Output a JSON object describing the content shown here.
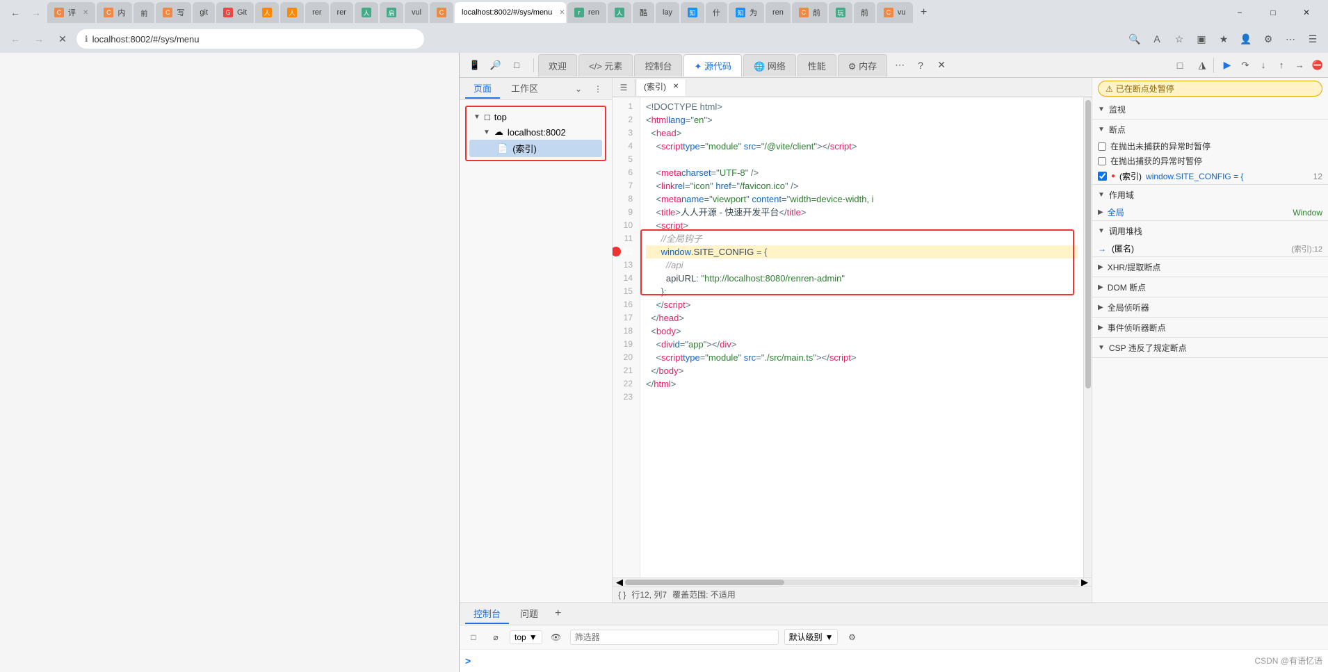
{
  "browser": {
    "url": "localhost:8002/#/sys/menu",
    "tabs": [
      {
        "id": "t1",
        "label": "C 评",
        "active": false,
        "favicon_color": "#e84"
      },
      {
        "id": "t2",
        "label": "C 内",
        "active": false,
        "favicon_color": "#e84"
      },
      {
        "id": "t3",
        "label": "前",
        "active": false,
        "favicon_color": "#e84"
      },
      {
        "id": "t4",
        "label": "C 写",
        "active": false,
        "favicon_color": "#e84"
      },
      {
        "id": "t5",
        "label": "git",
        "active": false,
        "favicon_color": "#888"
      },
      {
        "id": "t6",
        "label": "Git",
        "active": false,
        "favicon_color": "#e44"
      },
      {
        "id": "t7",
        "label": "人",
        "active": false,
        "favicon_color": "#f80"
      },
      {
        "id": "t8",
        "label": "人",
        "active": false,
        "favicon_color": "#f80"
      },
      {
        "id": "t9",
        "label": "rer",
        "active": false,
        "favicon_color": "#888"
      },
      {
        "id": "t10",
        "label": "rer",
        "active": false,
        "favicon_color": "#888"
      },
      {
        "id": "t11",
        "label": "人",
        "active": false,
        "favicon_color": "#4a8"
      },
      {
        "id": "t12",
        "label": "启",
        "active": false,
        "favicon_color": "#4a8"
      },
      {
        "id": "t13",
        "label": "vul",
        "active": false,
        "favicon_color": "#888"
      },
      {
        "id": "t14",
        "label": "C",
        "active": false,
        "favicon_color": "#e84"
      },
      {
        "id": "t15",
        "label": "localhost:8002/#/sys/menu",
        "active": true,
        "favicon_color": "#888"
      },
      {
        "id": "t16",
        "label": "ren",
        "active": false,
        "favicon_color": "#4a8"
      },
      {
        "id": "t17",
        "label": "人",
        "active": false,
        "favicon_color": "#4a8"
      },
      {
        "id": "t18",
        "label": "酷",
        "active": false,
        "favicon_color": "#888"
      },
      {
        "id": "t19",
        "label": "lay",
        "active": false,
        "favicon_color": "#888"
      },
      {
        "id": "t20",
        "label": "知",
        "active": false,
        "favicon_color": "#1890ff"
      },
      {
        "id": "t21",
        "label": "什",
        "active": false,
        "favicon_color": "#1890ff"
      },
      {
        "id": "t22",
        "label": "知",
        "active": false,
        "favicon_color": "#1890ff"
      },
      {
        "id": "t23",
        "label": "为",
        "active": false,
        "favicon_color": "#1890ff"
      },
      {
        "id": "t24",
        "label": "ren",
        "active": false,
        "favicon_color": "#888"
      },
      {
        "id": "t25",
        "label": "前",
        "active": false,
        "favicon_color": "#e84"
      },
      {
        "id": "t26",
        "label": "玩",
        "active": false,
        "favicon_color": "#4a8"
      },
      {
        "id": "t27",
        "label": "前",
        "active": false,
        "favicon_color": "#e84"
      },
      {
        "id": "t28",
        "label": "C vu",
        "active": false,
        "favicon_color": "#e84"
      }
    ]
  },
  "devtools": {
    "panel_tabs": [
      {
        "id": "device",
        "label": "📱",
        "active": false
      },
      {
        "id": "inspect",
        "label": "👆",
        "active": false
      },
      {
        "id": "toggle",
        "label": "◻",
        "active": false
      },
      {
        "id": "welcome",
        "label": "欢迎",
        "active": false
      },
      {
        "id": "elements",
        "label": "</> 元素",
        "active": false
      },
      {
        "id": "console",
        "label": "控制台",
        "active": false
      },
      {
        "id": "sources",
        "label": "✦ 源代码",
        "active": true
      },
      {
        "id": "network",
        "label": "🌐 网络",
        "active": false
      },
      {
        "id": "performance",
        "label": "性能",
        "active": false
      },
      {
        "id": "memory",
        "label": "⚙ 内存",
        "active": false
      },
      {
        "id": "more",
        "label": "…",
        "active": false
      },
      {
        "id": "close",
        "label": "✕",
        "active": false
      }
    ],
    "left_toolbar": {
      "page_label": "页面",
      "workspace_label": "工作区"
    },
    "file_tree": {
      "root": {
        "label": "top",
        "children": [
          {
            "label": "localhost:8002",
            "icon": "☁",
            "children": [
              {
                "label": "(索引)",
                "icon": "📄",
                "selected": true
              }
            ]
          }
        ]
      }
    },
    "source_file": {
      "name": "(索引)",
      "tab_label": "(索引)"
    },
    "code_lines": [
      {
        "num": 1,
        "content": "<!DOCTYPE html>"
      },
      {
        "num": 2,
        "content": "<html lang=\"en\">"
      },
      {
        "num": 3,
        "content": "  <head>"
      },
      {
        "num": 4,
        "content": "    <script type=\"module\" src=\"/@vite/client\"></script>"
      },
      {
        "num": 5,
        "content": ""
      },
      {
        "num": 6,
        "content": "    <meta charset=\"UTF-8\" />"
      },
      {
        "num": 7,
        "content": "    <link rel=\"icon\" href=\"/favicon.ico\" />"
      },
      {
        "num": 8,
        "content": "    <meta name=\"viewport\" content=\"width=device-width, i"
      },
      {
        "num": 9,
        "content": "    <title>人人开源 - 快速开发平台</title>"
      },
      {
        "num": 10,
        "content": "    <script>"
      },
      {
        "num": 11,
        "content": "      //全局钩子"
      },
      {
        "num": 12,
        "content": "      window.SITE_CONFIG = {",
        "highlighted": true,
        "breakpoint": true
      },
      {
        "num": 13,
        "content": "        //api"
      },
      {
        "num": 14,
        "content": "        apiURL: \"http://localhost:8080/renren-admin\""
      },
      {
        "num": 15,
        "content": "      };"
      },
      {
        "num": 16,
        "content": "    </script>"
      },
      {
        "num": 17,
        "content": "  </head>"
      },
      {
        "num": 18,
        "content": "  <body>"
      },
      {
        "num": 19,
        "content": "    <div id=\"app\"></div>"
      },
      {
        "num": 20,
        "content": "    <script type=\"module\" src=\"./src/main.ts\"></script>"
      },
      {
        "num": 21,
        "content": "  </body>"
      },
      {
        "num": 22,
        "content": "</html>"
      },
      {
        "num": 23,
        "content": ""
      }
    ],
    "status_bar": {
      "left": "{ }",
      "line": "行12, 列7",
      "coverage": "覆盖范围: 不适用"
    }
  },
  "debugger": {
    "paused_label": "已在断点处暂停",
    "sections": {
      "watch": "监视",
      "breakpoints": "断点",
      "breakpoint_options": [
        "在抛出未捕获的异常时暂停",
        "在抛出捕获的异常时暂停"
      ],
      "call_stack_label": "(索引)",
      "call_stack_active": "window.SITE_CONFIG = {",
      "call_stack_line": "12",
      "scope_label": "作用域",
      "scope_items": [
        {
          "name": "全局",
          "value": "Window"
        }
      ],
      "call_stack": "调用堆栈",
      "call_stack_item": "(匿名)",
      "call_stack_item_source": "(索引):12",
      "xhr_breakpoints": "XHR/提取断点",
      "dom_breakpoints": "DOM 断点",
      "global_listeners": "全局侦听器",
      "event_listeners": "事件侦听器断点",
      "csp_violations": "CSP 违反了规定断点"
    },
    "toolbar_buttons": [
      "▶",
      "⬛",
      "⏭",
      "⬇",
      "⬆",
      "➡",
      "🚫"
    ]
  },
  "bottom_panel": {
    "tabs": [
      "控制台",
      "问题"
    ],
    "console": {
      "context": "top",
      "filter_placeholder": "筛选器",
      "level": "默认级别",
      "prompt": ">"
    }
  },
  "watermark": "CSDN @有语忆语"
}
